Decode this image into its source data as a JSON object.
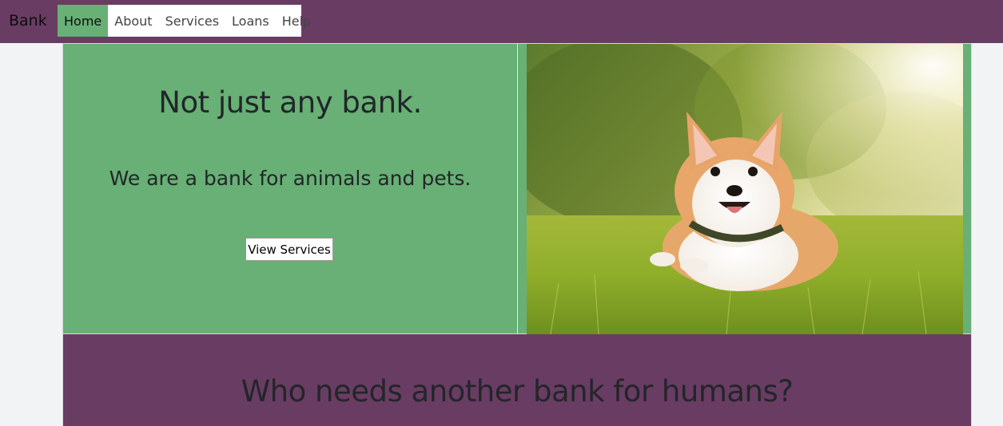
{
  "nav": {
    "brand": "Bank",
    "links": [
      {
        "label": "Home",
        "active": true
      },
      {
        "label": "About"
      },
      {
        "label": "Services"
      },
      {
        "label": "Loans"
      },
      {
        "label": "Help"
      }
    ]
  },
  "hero": {
    "title": "Not just any bank.",
    "subtitle": "We are a bank for animals and pets.",
    "button_label": "View Services",
    "image_subject": "corgi-in-grass-photo"
  },
  "section2": {
    "title": "Who needs another bank for humans?"
  },
  "colors": {
    "nav_bg": "#693c63",
    "accent_green": "#68b075",
    "page_bg": "#f1f3f5"
  }
}
